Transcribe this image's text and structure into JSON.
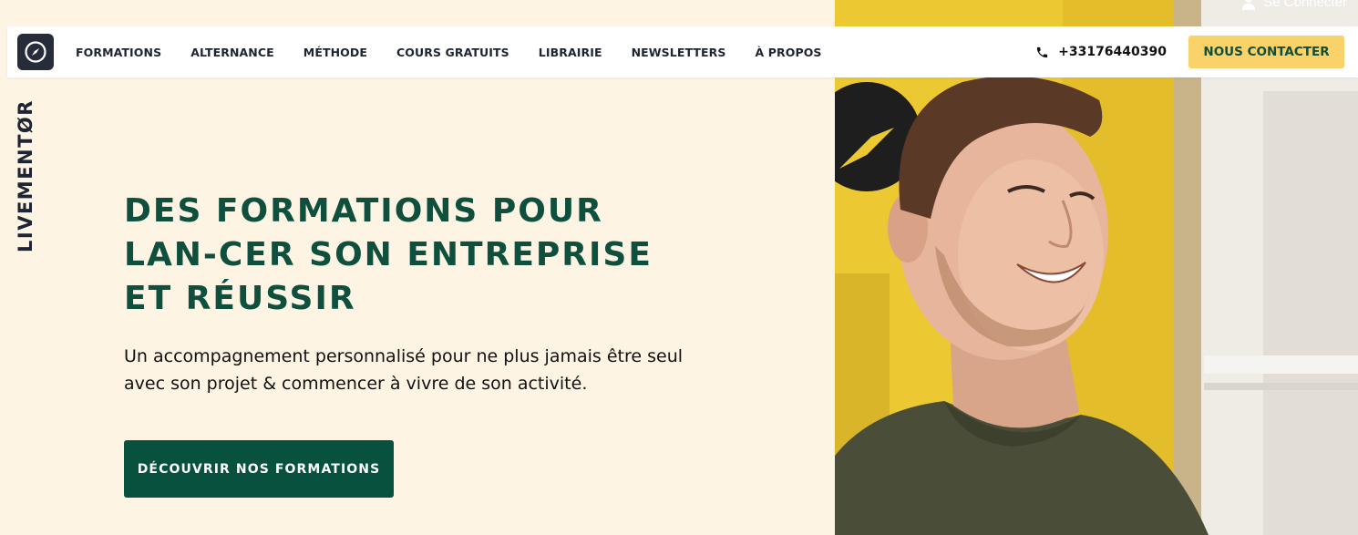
{
  "header": {
    "login_label": "Se Connecter",
    "brand": "LIVEMENTØR",
    "menu": [
      {
        "label": "FORMATIONS"
      },
      {
        "label": "ALTERNANCE"
      },
      {
        "label": "MÉTHODE"
      },
      {
        "label": "COURS GRATUITS"
      },
      {
        "label": "LIBRAIRIE"
      },
      {
        "label": "NEWSLETTERS"
      },
      {
        "label": "À PROPOS"
      }
    ],
    "phone": "+33176440390",
    "contact_label": "NOUS CONTACTER"
  },
  "hero": {
    "title": "DES FORMATIONS POUR LAN-CER SON ENTREPRISE ET RÉUSSIR",
    "subtitle": "Un accompagnement personnalisé pour ne plus jamais être seul avec son projet & commencer à vivre de son activité.",
    "cta_label": "DÉCOUVRIR NOS FORMATIONS"
  },
  "icons": {
    "logo": "compass-logo-icon",
    "phone": "phone-icon",
    "user": "user-icon"
  },
  "colors": {
    "background": "#fdf4e3",
    "primary_green": "#0f4f3d",
    "accent_yellow": "#f9d269",
    "dark": "#1d2433"
  }
}
